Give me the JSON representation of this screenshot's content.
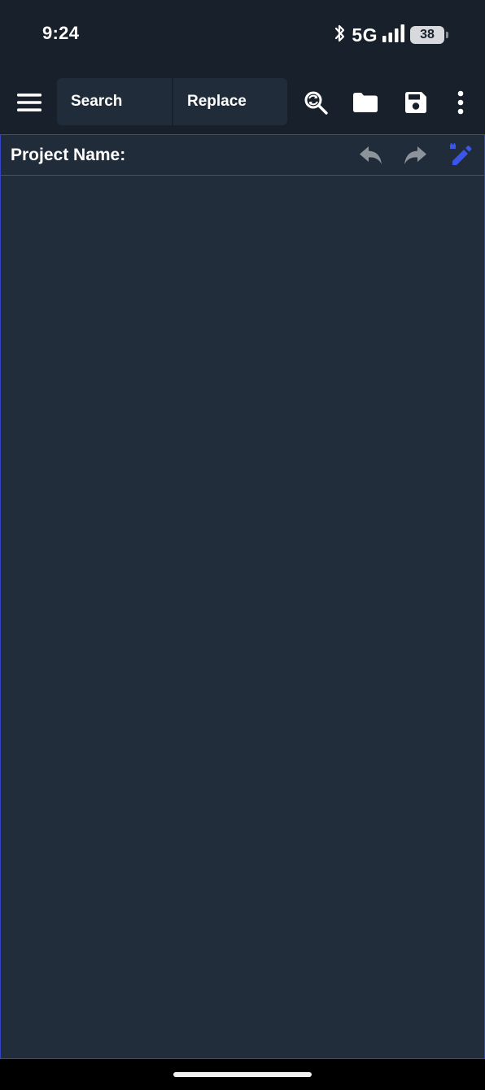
{
  "status_bar": {
    "time": "9:24",
    "network": "5G",
    "battery_level": "38",
    "icons": [
      "bluetooth-icon",
      "signal-icon",
      "battery-icon"
    ]
  },
  "toolbar": {
    "search_label": "Search",
    "replace_label": "Replace",
    "icons": [
      "menu-icon",
      "search-replace-icon",
      "folder-icon",
      "save-icon",
      "more-vertical-icon"
    ]
  },
  "project_bar": {
    "label": "Project Name:",
    "icons": [
      "undo-icon",
      "redo-icon",
      "edit-lock-icon"
    ]
  },
  "editor": {
    "content": ""
  },
  "colors": {
    "background": "#18202b",
    "panel": "#212c3a",
    "editor": "#222d3b",
    "accent": "#3443c8",
    "edit_icon": "#3a55e8",
    "muted_icon": "#8c939b"
  }
}
